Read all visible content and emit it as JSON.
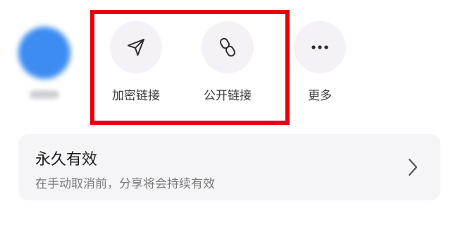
{
  "share_targets": [
    {
      "id": "blurred-app",
      "label": ""
    },
    {
      "id": "encrypted-link",
      "label": "加密链接",
      "icon": "send-icon"
    },
    {
      "id": "public-link",
      "label": "公开链接",
      "icon": "link-icon"
    },
    {
      "id": "more",
      "label": "更多",
      "icon": "more-dots-icon"
    }
  ],
  "validity_card": {
    "title": "永久有效",
    "subtitle": "在手动取消前，分享将会持续有效",
    "icon": "chevron-right-icon"
  },
  "colors": {
    "highlight": "#e8000f",
    "icon_bg": "#f4f2f6",
    "card_bg": "#f5f5f7",
    "blurred_app": "#3d8cf2"
  }
}
